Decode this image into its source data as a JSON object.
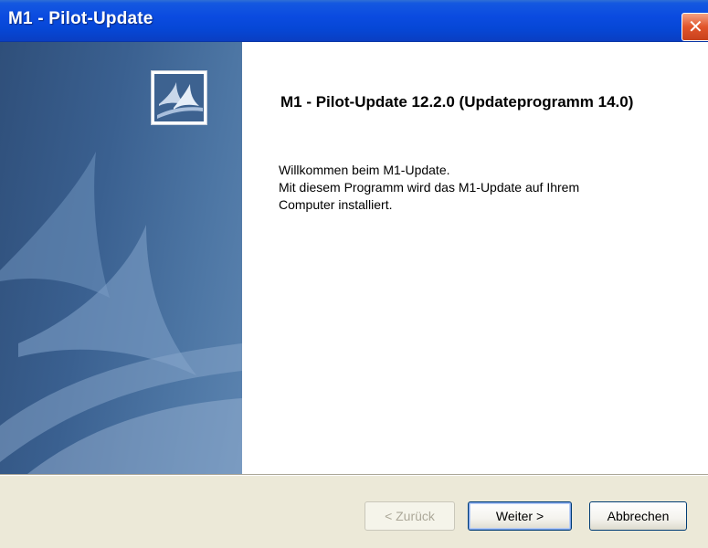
{
  "window": {
    "title": "M1 - Pilot-Update",
    "close_glyph": "✕"
  },
  "content": {
    "heading": "M1 - Pilot-Update 12.2.0 (Updateprogramm 14.0)",
    "description_lines": [
      "Willkommen beim M1-Update.",
      "Mit diesem Programm wird das M1-Update auf Ihrem",
      "Computer installiert."
    ]
  },
  "buttons": {
    "back": "< Zurück",
    "next": "Weiter >",
    "cancel": "Abbrechen"
  },
  "colors": {
    "titlebar": "#0b4be0",
    "side_panel": "#3a6090",
    "close_button": "#e1542b",
    "dialog_background": "#ece9d8"
  },
  "icons": {
    "logo": "sail-logo-icon",
    "close": "close-icon"
  }
}
